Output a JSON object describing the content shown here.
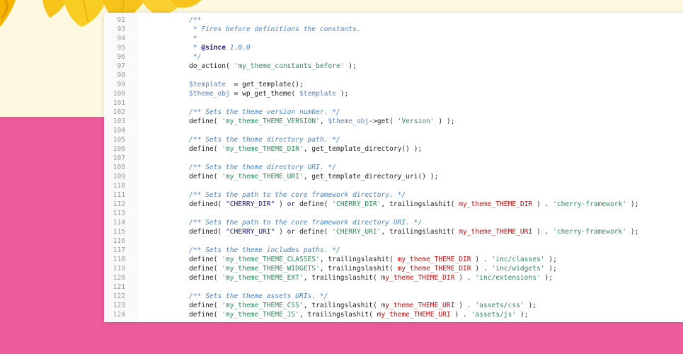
{
  "colors": {
    "pink": "#ee5b9a",
    "cream": "#fdf9e1",
    "comment": "#4a82c4",
    "string": "#2e8b57",
    "constant": "#c01010",
    "variable": "#5b7fbf"
  },
  "code_lines": [
    {
      "n": "92",
      "t": "/**"
    },
    {
      "n": "93",
      "t": " * Fires before definitions the constants."
    },
    {
      "n": "94",
      "t": " *"
    },
    {
      "n": "95",
      "t": " * @since 1.0.0"
    },
    {
      "n": "96",
      "t": " */"
    },
    {
      "n": "97",
      "t": "do_action( 'my_theme_constants_before' );"
    },
    {
      "n": "98",
      "t": ""
    },
    {
      "n": "99",
      "t": "$template  = get_template();"
    },
    {
      "n": "100",
      "t": "$theme_obj = wp_get_theme( $template );"
    },
    {
      "n": "101",
      "t": ""
    },
    {
      "n": "102",
      "t": "/** Sets the theme version number. */"
    },
    {
      "n": "103",
      "t": "define( 'my_theme_THEME_VERSION', $theme_obj->get( 'Version' ) );"
    },
    {
      "n": "104",
      "t": ""
    },
    {
      "n": "105",
      "t": "/** Sets the theme directory path. */"
    },
    {
      "n": "106",
      "t": "define( 'my_theme_THEME_DIR', get_template_directory() );"
    },
    {
      "n": "107",
      "t": ""
    },
    {
      "n": "108",
      "t": "/** Sets the theme directory URI. */"
    },
    {
      "n": "109",
      "t": "define( 'my_theme_THEME_URI', get_template_directory_uri() );"
    },
    {
      "n": "110",
      "t": ""
    },
    {
      "n": "111",
      "t": "/** Sets the path to the core framework directory. */"
    },
    {
      "n": "112",
      "t": "defined( \"CHERRY_DIR\" ) or define( 'CHERRY_DIR', trailingslashit( my_theme_THEME_DIR ) . 'cherry-framework' );"
    },
    {
      "n": "113",
      "t": ""
    },
    {
      "n": "114",
      "t": "/** Sets the path to the core framework directory URI. */"
    },
    {
      "n": "115",
      "t": "defined( \"CHERRY_URI\" ) or define( 'CHERRY_URI', trailingslashit( my_theme_THEME_URI ) . 'cherry-framework' );"
    },
    {
      "n": "116",
      "t": ""
    },
    {
      "n": "117",
      "t": "/** Sets the theme includes paths. */"
    },
    {
      "n": "118",
      "t": "define( 'my_theme_THEME_CLASSES', trailingslashit( my_theme_THEME_DIR ) . 'inc/classes' );"
    },
    {
      "n": "119",
      "t": "define( 'my_theme_THEME_WIDGETS', trailingslashit( my_theme_THEME_DIR ) . 'inc/widgets' );"
    },
    {
      "n": "120",
      "t": "define( 'my_theme_THEME_EXT', trailingslashit( my_theme_THEME_DIR ) . 'inc/extensions' );"
    },
    {
      "n": "121",
      "t": ""
    },
    {
      "n": "122",
      "t": "/** Sets the theme assets URIs. */"
    },
    {
      "n": "123",
      "t": "define( 'my_theme_THEME_CSS', trailingslashit( my_theme_THEME_URI ) . 'assets/css' );"
    },
    {
      "n": "124",
      "t": "define( 'my_theme_THEME_JS', trailingslashit( my_theme_THEME_URI ) . 'assets/js' );"
    }
  ]
}
